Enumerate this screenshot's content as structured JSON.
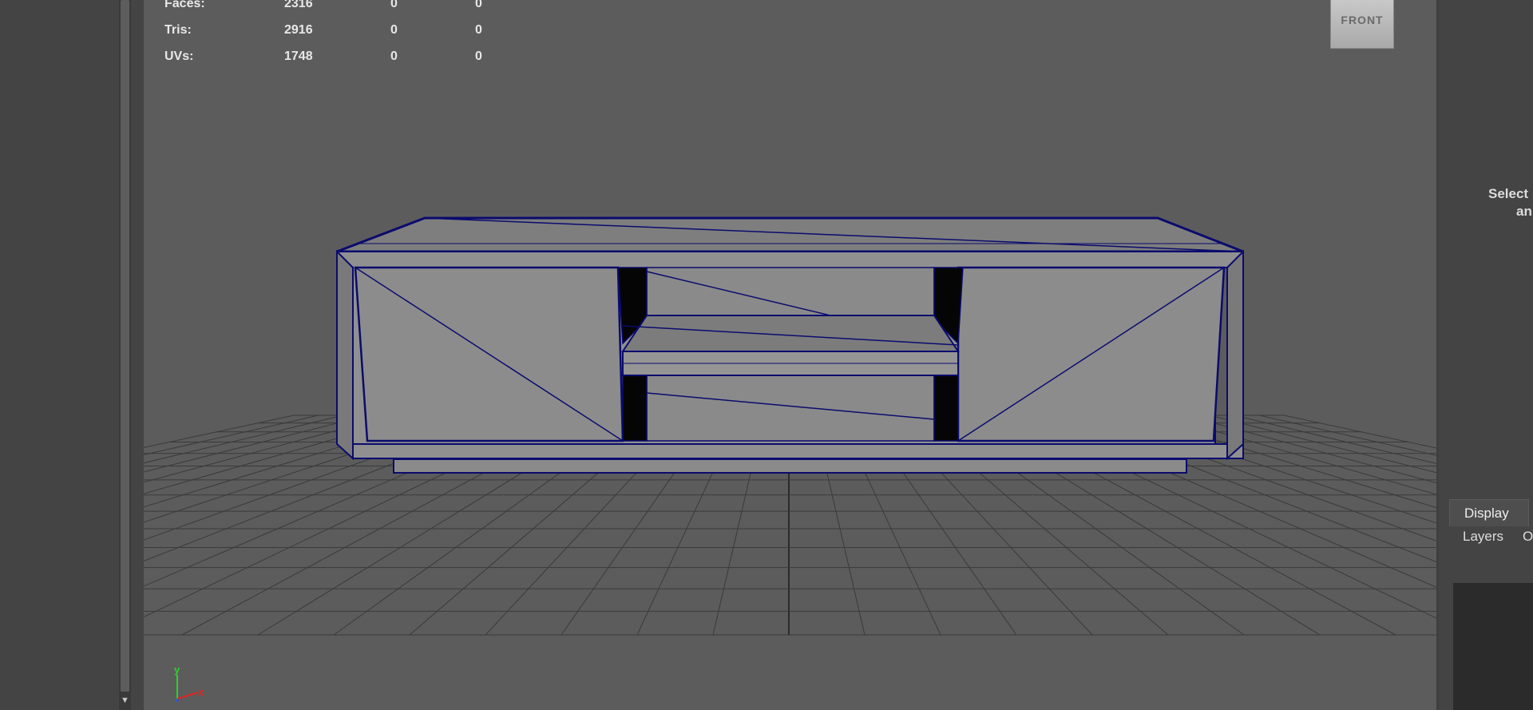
{
  "hud": {
    "rows": [
      {
        "label": "Faces:",
        "v1": "2316",
        "v2": "0",
        "v3": "0"
      },
      {
        "label": "Tris:",
        "v1": "2916",
        "v2": "0",
        "v3": "0"
      },
      {
        "label": "UVs:",
        "v1": "1748",
        "v2": "0",
        "v3": "0"
      }
    ]
  },
  "viewcube": {
    "label": "FRONT"
  },
  "side_panel": {
    "hint_line1": "Select",
    "hint_line2": "an"
  },
  "layer_editor": {
    "tab_display": "Display",
    "menu_layers": "Layers",
    "menu_options": "O"
  },
  "axis": {
    "y": "y",
    "x": "x"
  },
  "colors": {
    "viewport_bg": "#5c5c5c",
    "grid": "#3a3a3a",
    "grid_axis": "#2a2a2a",
    "wire": "#0b0b6e",
    "surface_light": "#8c8c8c",
    "surface_top": "#7e7e7e",
    "surface_dark": "#050505",
    "axis_y": "#2ad42a",
    "axis_x": "#e02424",
    "axis_z": "#2a5ad4"
  },
  "icons": {
    "scroll_down": "triangle-down-icon",
    "axis_gizmo": "axis-gizmo-icon"
  }
}
